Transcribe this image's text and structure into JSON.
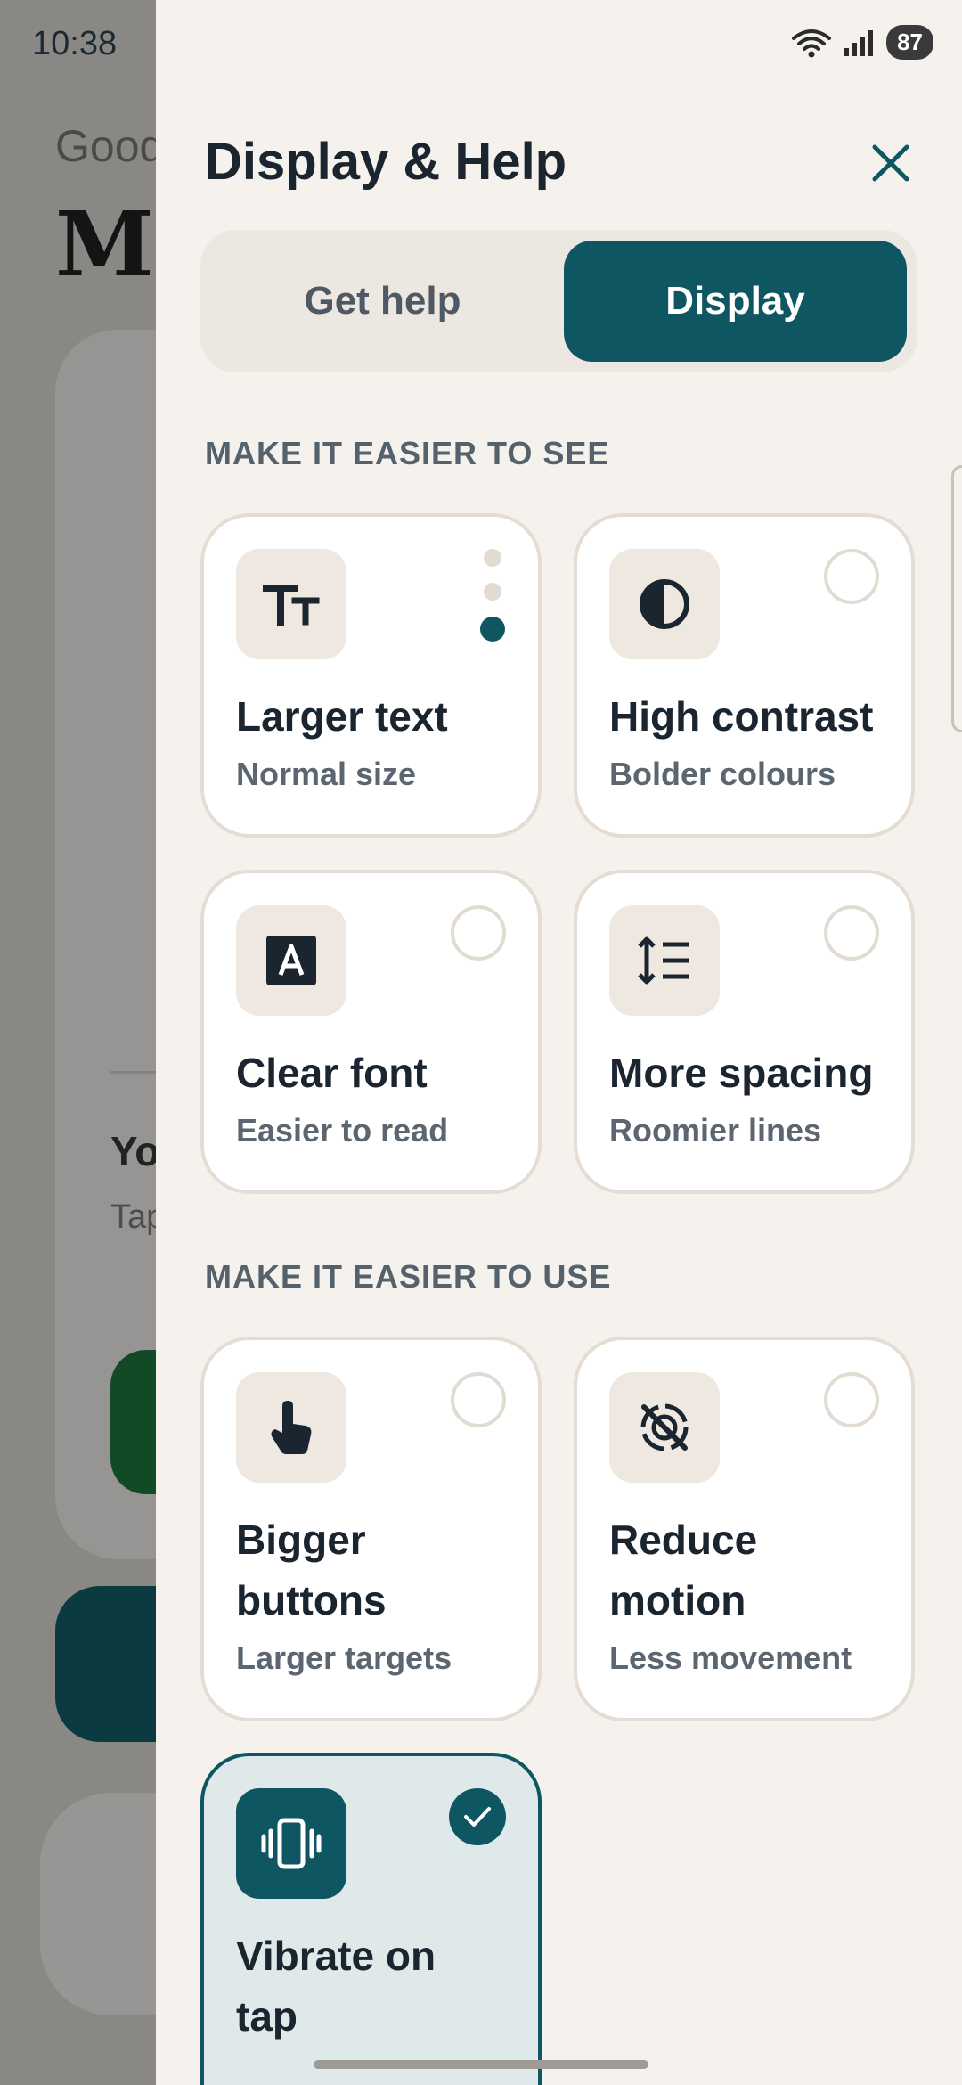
{
  "status_bar": {
    "time": "10:38",
    "battery": "87"
  },
  "background": {
    "greeting": "Good",
    "name": "Ma",
    "card_heading": "Yo",
    "card_hint": "Tap"
  },
  "drawer": {
    "title": "Display & Help",
    "tabs": [
      {
        "label": "Get help",
        "selected": false
      },
      {
        "label": "Display",
        "selected": true
      }
    ],
    "sections": [
      {
        "label": "MAKE IT EASIER TO SEE",
        "cards": [
          {
            "title": "Larger text",
            "subtitle": "Normal size",
            "icon": "text-size-icon",
            "control": "level-dots",
            "level": "1 of 3"
          },
          {
            "title": "High contrast",
            "subtitle": "Bolder colours",
            "icon": "contrast-icon",
            "control": "radio",
            "selected": false
          },
          {
            "title": "Clear font",
            "subtitle": "Easier to read",
            "icon": "font-icon",
            "control": "radio",
            "selected": false
          },
          {
            "title": "More spacing",
            "subtitle": "Roomier lines",
            "icon": "line-spacing-icon",
            "control": "radio",
            "selected": false
          }
        ]
      },
      {
        "label": "MAKE IT EASIER TO USE",
        "cards": [
          {
            "title": "Bigger buttons",
            "subtitle": "Larger targets",
            "icon": "tap-finger-icon",
            "control": "radio",
            "selected": false
          },
          {
            "title": "Reduce motion",
            "subtitle": "Less movement",
            "icon": "motion-off-icon",
            "control": "radio",
            "selected": false
          },
          {
            "title": "Vibrate on tap",
            "subtitle": "",
            "icon": "vibrate-icon",
            "control": "check",
            "selected": true
          }
        ]
      }
    ]
  },
  "colors": {
    "accent": "#0e5661",
    "background": "#f5f2ee",
    "card_border": "#e5ddd3",
    "active_card": "#dfe9e9"
  }
}
